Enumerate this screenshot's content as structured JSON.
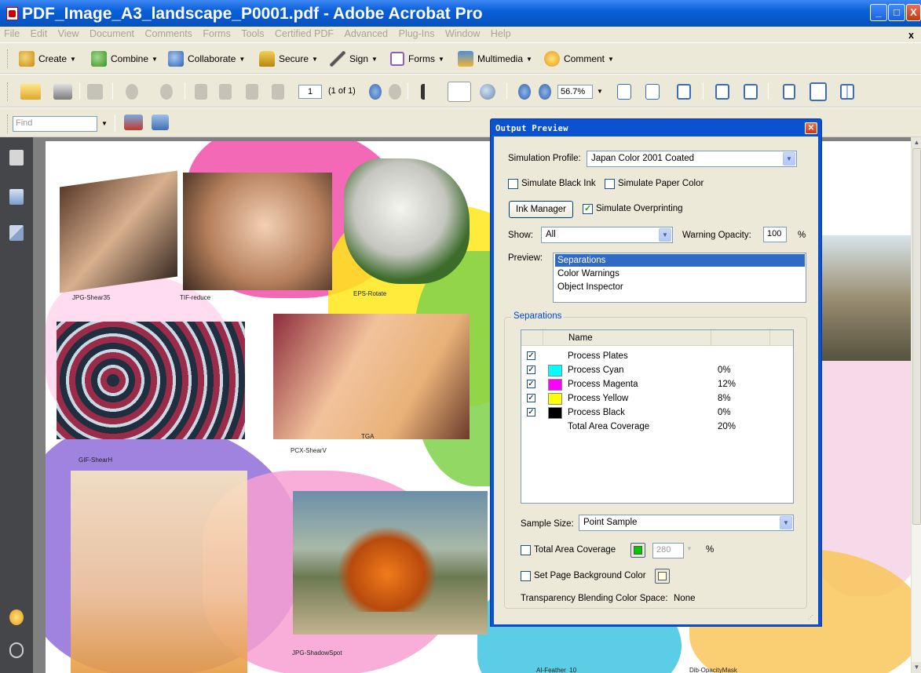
{
  "window": {
    "title": "PDF_Image_A3_landscape_P0001.pdf - Adobe Acrobat Pro",
    "min_label": "_",
    "max_label": "□",
    "close_label": "X"
  },
  "menu": {
    "items": [
      "File",
      "Edit",
      "View",
      "Document",
      "Comments",
      "Forms",
      "Tools",
      "Certified PDF",
      "Advanced",
      "Plug-Ins",
      "Window",
      "Help"
    ],
    "close_doc_label": "x"
  },
  "tasks_toolbar": {
    "create": "Create",
    "combine": "Combine",
    "collaborate": "Collaborate",
    "secure": "Secure",
    "sign": "Sign",
    "forms": "Forms",
    "multimedia": "Multimedia",
    "comment": "Comment"
  },
  "page_toolbar": {
    "current_page": "1",
    "page_count": "(1 of 1)",
    "zoom_value": "56.7%"
  },
  "find_toolbar": {
    "find_placeholder": "Find"
  },
  "page_labels": {
    "jpg_shear35": "JPG-Shear35",
    "tif_reduce": "TIF-reduce",
    "eps_rotate": "EPS-Rotate",
    "gif_shearh": "GIF-ShearH",
    "pcx_shearv": "PCX-ShearV",
    "tga": "TGA",
    "jpg_shadowspot": "JPG-ShadowSpot",
    "ai_feather": "AI-Feather_10",
    "dib_opacitymask": "Dib-OpacityMask"
  },
  "output_preview": {
    "title": "Output Preview",
    "simulation_profile_label": "Simulation Profile:",
    "simulation_profile_value": "Japan Color 2001 Coated",
    "simulate_black_ink_label": "Simulate Black Ink",
    "simulate_black_ink_checked": false,
    "simulate_paper_color_label": "Simulate Paper Color",
    "simulate_paper_color_checked": false,
    "ink_manager_label": "Ink Manager",
    "simulate_overprinting_label": "Simulate Overprinting",
    "simulate_overprinting_checked": true,
    "show_label": "Show:",
    "show_value": "All",
    "warning_opacity_label": "Warning Opacity:",
    "warning_opacity_value": "100",
    "percent_sign": "%",
    "preview_label": "Preview:",
    "preview_options": [
      "Separations",
      "Color Warnings",
      "Object Inspector"
    ],
    "preview_selected": "Separations",
    "separations_group_label": "Separations",
    "separations_column_name": "Name",
    "separations": [
      {
        "name": "Process Plates",
        "value": "",
        "checked": true,
        "color": ""
      },
      {
        "name": "Process Cyan",
        "value": "0%",
        "checked": true,
        "color": "#00ffff"
      },
      {
        "name": "Process Magenta",
        "value": "12%",
        "checked": true,
        "color": "#ff00ff"
      },
      {
        "name": "Process Yellow",
        "value": "8%",
        "checked": true,
        "color": "#ffff00"
      },
      {
        "name": "Process Black",
        "value": "0%",
        "checked": true,
        "color": "#000000"
      },
      {
        "name": "Total Area Coverage",
        "value": "20%",
        "checked": false,
        "color": ""
      }
    ],
    "sample_size_label": "Sample Size:",
    "sample_size_value": "Point Sample",
    "total_area_coverage_label": "Total Area Coverage",
    "total_area_coverage_checked": false,
    "total_area_coverage_color": "#00c800",
    "total_area_coverage_value": "280",
    "set_page_bg_label": "Set Page Background Color",
    "set_page_bg_checked": false,
    "page_bg_color": "#ffffe0",
    "blending_space_label": "Transparency Blending Color Space:",
    "blending_space_value": "None"
  }
}
